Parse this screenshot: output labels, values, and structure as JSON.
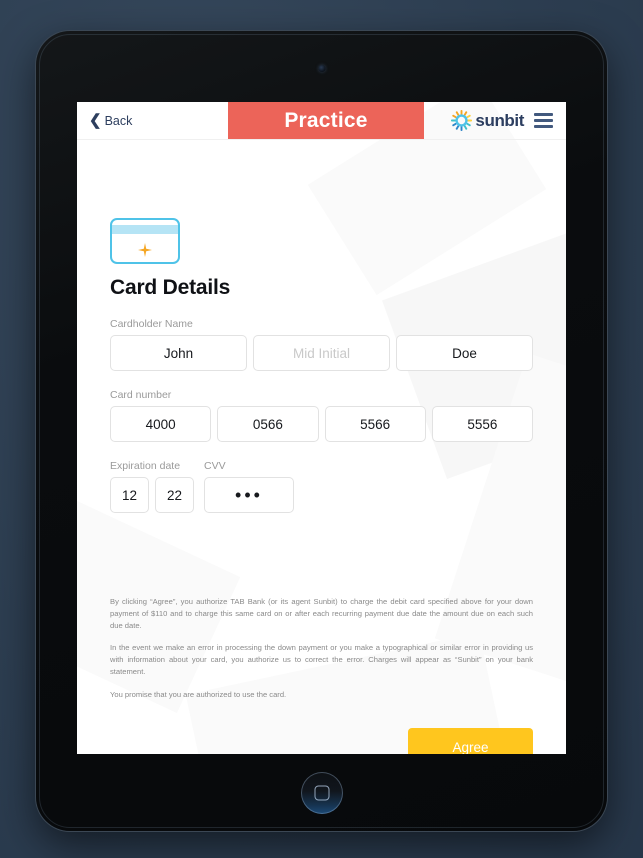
{
  "device": {
    "type": "tablet",
    "camera_icon": "camera-dot",
    "home_button_icon": "home-square-icon"
  },
  "topbar": {
    "back_label": "Back",
    "back_icon": "chevron-left-icon",
    "practice_label": "Practice",
    "brand_name": "sunbit",
    "brand_icon": "sunburst-logo-icon",
    "menu_icon": "hamburger-menu-icon",
    "banner_color": "#EC6459",
    "brand_text_color": "#2C3E60"
  },
  "main": {
    "card_icon": "credit-card-icon",
    "card_icon_border_color": "#4FC3E8",
    "card_icon_stripe_color": "#B5E4F5",
    "card_icon_sparkle_color": "#F5A623",
    "title": "Card Details",
    "cardholder": {
      "label": "Cardholder Name",
      "first_name": "John",
      "middle_initial_placeholder": "Mid Initial",
      "middle_initial_value": "",
      "last_name": "Doe"
    },
    "card_number": {
      "label": "Card number",
      "groups": [
        "4000",
        "0566",
        "5566",
        "5556"
      ]
    },
    "expiration": {
      "label": "Expiration date",
      "month": "12",
      "year": "22"
    },
    "cvv": {
      "label": "CVV",
      "masked_value": "•••"
    }
  },
  "legal": {
    "paragraph_1": "By clicking “Agree”, you authorize TAB Bank (or its agent Sunbit) to charge the debit card specified above for your down payment of $110 and to charge this same card on or after each recurring payment due date the amount due on each such due date.",
    "paragraph_2": "In the event we make an error in processing the down payment or you make a typographical or similar error in providing us with information about your card, you authorize us to correct the error. Charges will appear as “Sunbit” on your bank statement.",
    "paragraph_3": "You promise that you are authorized to use the card."
  },
  "footer": {
    "agree_label": "Agree",
    "agree_color": "#FFC61E"
  }
}
